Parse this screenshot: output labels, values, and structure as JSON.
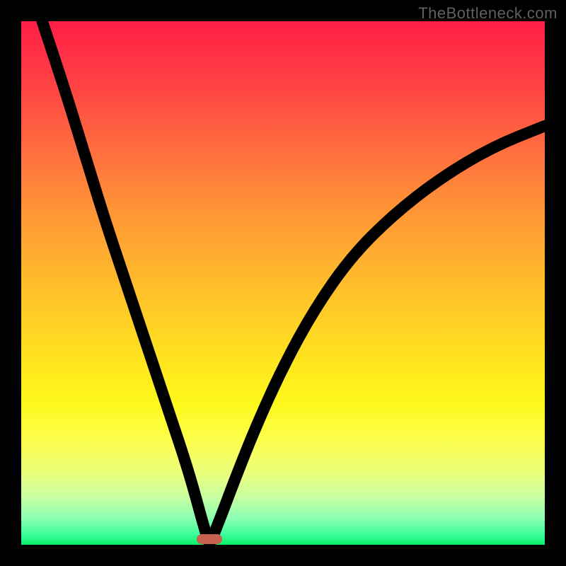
{
  "watermark": "TheBottleneck.com",
  "colors": {
    "frame_bg": "#000000",
    "watermark_text": "#606060",
    "curve_stroke": "#000000",
    "minimum_marker": "#c5614e",
    "gradient_top": "#ff1f46",
    "gradient_bottom": "#0aee67"
  },
  "chart_data": {
    "type": "line",
    "title": "",
    "xlabel": "",
    "ylabel": "",
    "xlim": [
      0,
      100
    ],
    "ylim": [
      0,
      100
    ],
    "grid": false,
    "annotations": [
      {
        "text": "minimum marker",
        "x": 36,
        "y": 0
      }
    ],
    "series": [
      {
        "name": "left-branch",
        "x": [
          4,
          8,
          12,
          16,
          20,
          24,
          28,
          32,
          35,
          36
        ],
        "y": [
          100,
          88,
          75,
          62,
          50,
          38,
          26,
          14,
          3,
          0
        ]
      },
      {
        "name": "right-branch",
        "x": [
          36,
          38,
          41,
          45,
          50,
          56,
          63,
          71,
          80,
          90,
          100
        ],
        "y": [
          0,
          5,
          13,
          23,
          34,
          45,
          55,
          63,
          70,
          76,
          80
        ]
      }
    ],
    "minimum": {
      "x": 36,
      "y": 0
    }
  }
}
